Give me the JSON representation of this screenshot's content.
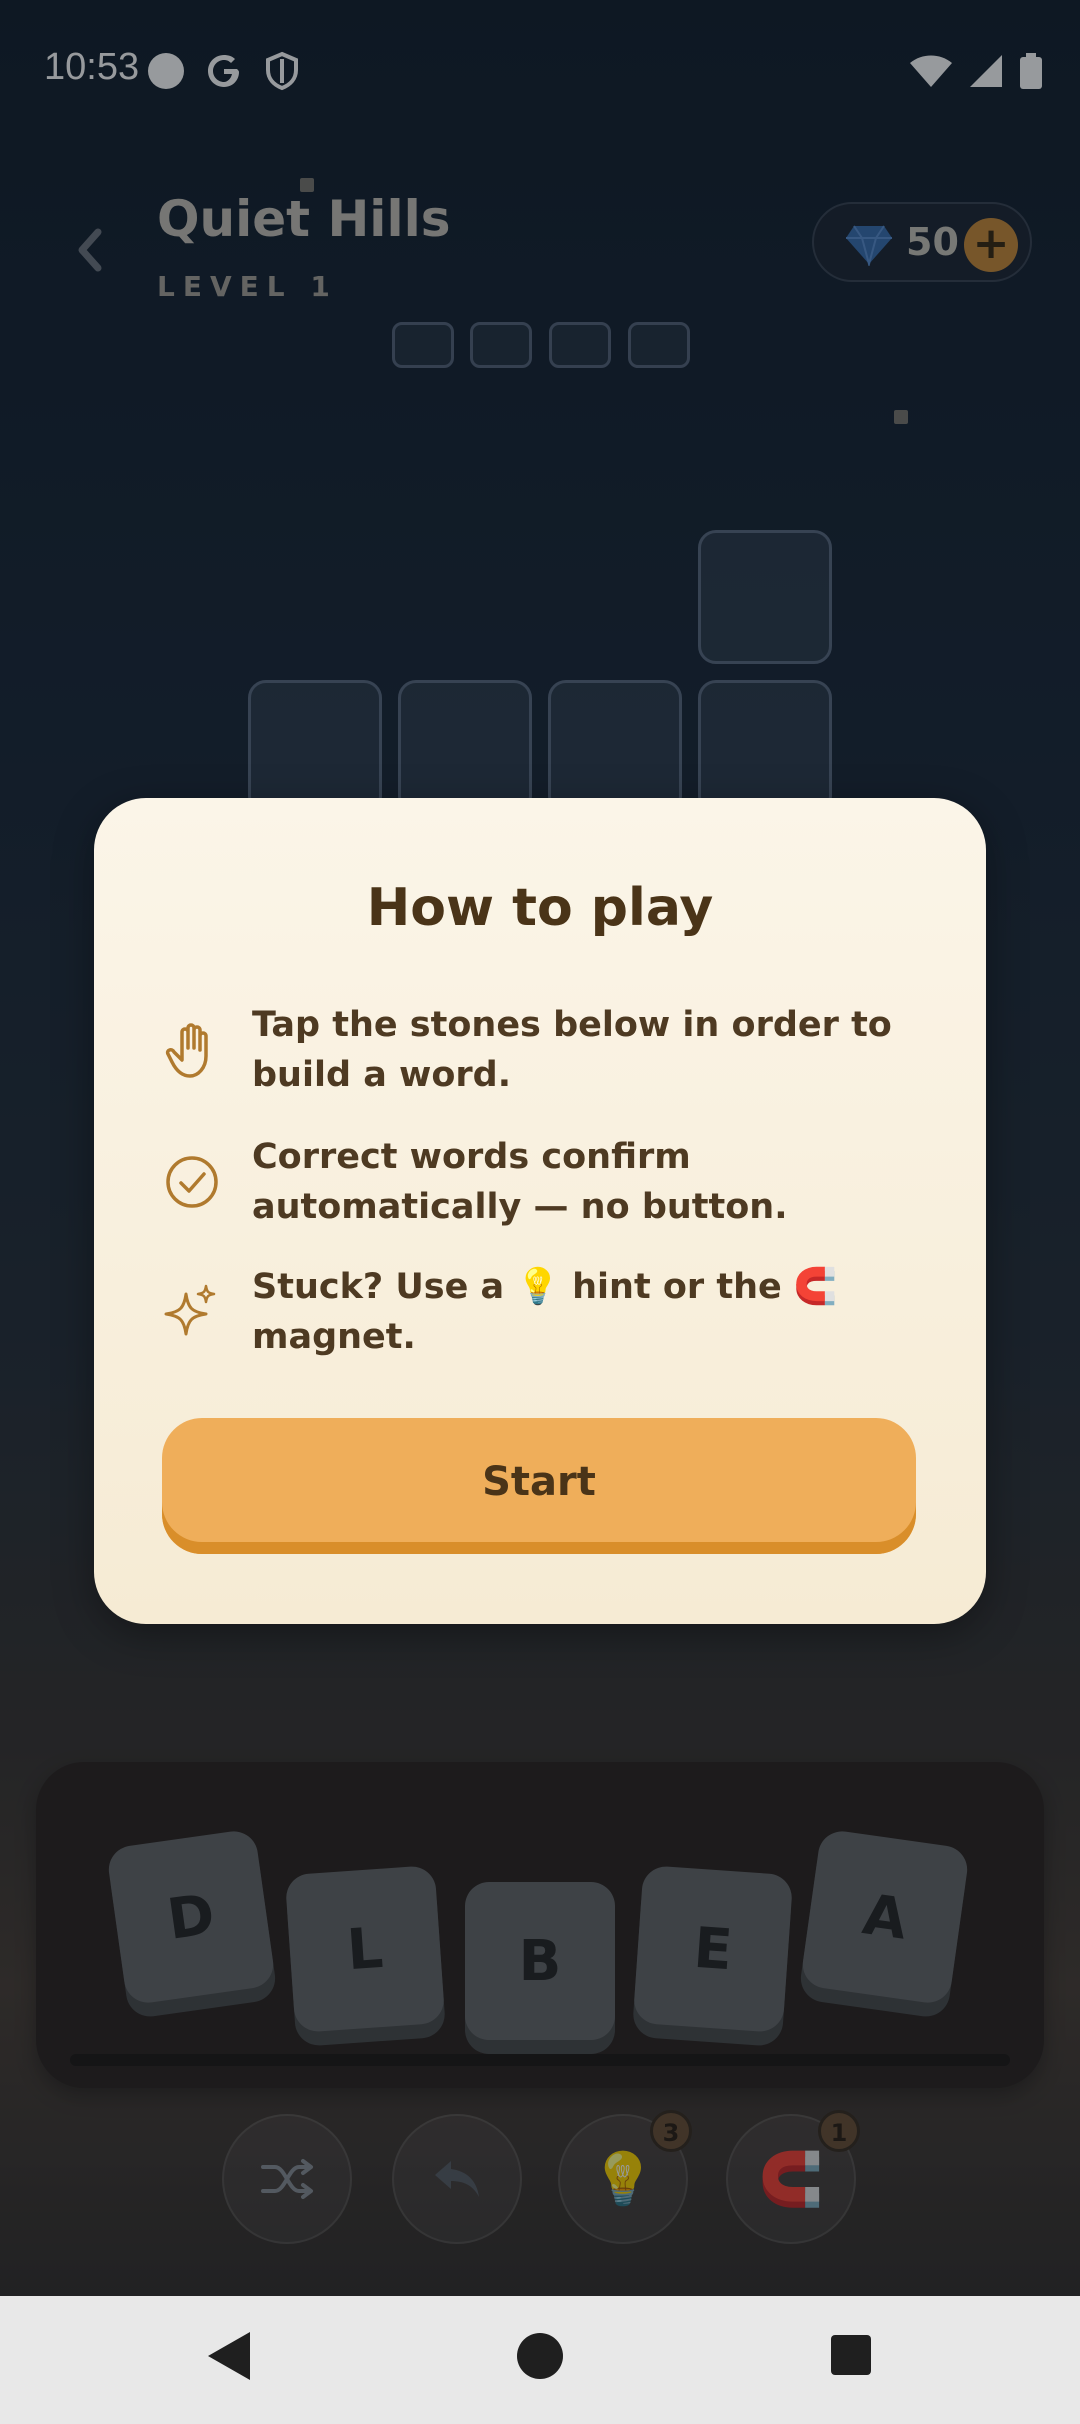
{
  "status_bar": {
    "time": "10:53"
  },
  "header": {
    "level_title": "Quiet Hills",
    "level_subtitle": "LEVEL 1",
    "gems": "50",
    "plus_label": "+"
  },
  "tray": {
    "stones": [
      "D",
      "L",
      "B",
      "E",
      "A"
    ]
  },
  "actions": {
    "hint_count": "3",
    "magnet_count": "1"
  },
  "modal": {
    "title": "How to play",
    "rules": [
      {
        "icon": "hand-icon",
        "text": "Tap the stones below in order to build a word."
      },
      {
        "icon": "check-circle-icon",
        "text": "Correct words confirm automatically — no button."
      },
      {
        "icon": "sparkles-icon",
        "text": "Stuck? Use a 💡 hint or the 🧲 magnet."
      }
    ],
    "start_label": "Start"
  },
  "colors": {
    "accent": "#efae5a",
    "modal_bg": "#fbf5e8",
    "title_text": "#4a3418",
    "icon_stroke": "#b07a2e"
  }
}
